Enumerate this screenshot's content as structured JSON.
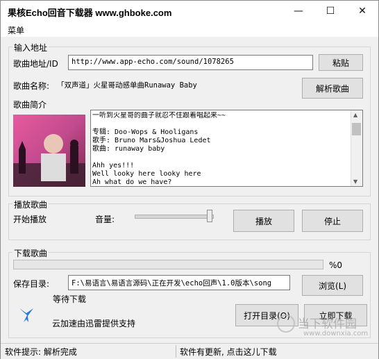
{
  "window": {
    "title": "果核Echo回音下载器 www.ghboke.com",
    "controls": {
      "minimize": "—",
      "maximize": "☐",
      "close": "✕"
    }
  },
  "menu": {
    "label": "菜单"
  },
  "input_group": {
    "legend": "输入地址",
    "url_label": "歌曲地址/ID",
    "url_value": "http://www.app-echo.com/sound/1078265",
    "paste_button": "粘贴",
    "name_label": "歌曲名称:",
    "name_value": "「双声道」火星哥动感单曲Runaway Baby",
    "parse_button": "解析歌曲",
    "intro_label": "歌曲简介",
    "intro_lines": [
      "一听到火星哥的曲子就忍不住跟着唱起来~~",
      "",
      "专辑: Doo-Wops & Hooligans",
      "歌手: Bruno Mars&Joshua Ledet",
      "歌曲: runaway baby",
      "",
      "Ahh yes!!!",
      "Well looky here looky here",
      "Ah what do we have?"
    ]
  },
  "play_group": {
    "legend": "播放歌曲",
    "status": "开始播放",
    "volume_label": "音量:",
    "volume_level": 1.0,
    "play_button": "播放",
    "stop_button": "停止"
  },
  "download_group": {
    "legend": "下载歌曲",
    "progress_value": 0,
    "progress_text": "%0",
    "dir_label": "保存目录:",
    "dir_value": "F:\\易语言\\易语言源码\\正在开发\\echo回声\\1.0版本\\song",
    "browse_button": "浏览(L)",
    "wait_text": "等待下载",
    "open_dir_button": "打开目录(O)",
    "download_button": "立即下载",
    "accel_text": "云加速由迅雷提供支持"
  },
  "statusbar": {
    "hint": "软件提示: 解析完成",
    "update": "软件有更新, 点击这儿下载"
  },
  "watermark": {
    "brand": "当下软件园",
    "url": "www.downxia.com"
  },
  "colors": {
    "accent": "#2e7bd6",
    "window_bg": "#f0f0f0",
    "button_bg": "#e1e1e1"
  }
}
